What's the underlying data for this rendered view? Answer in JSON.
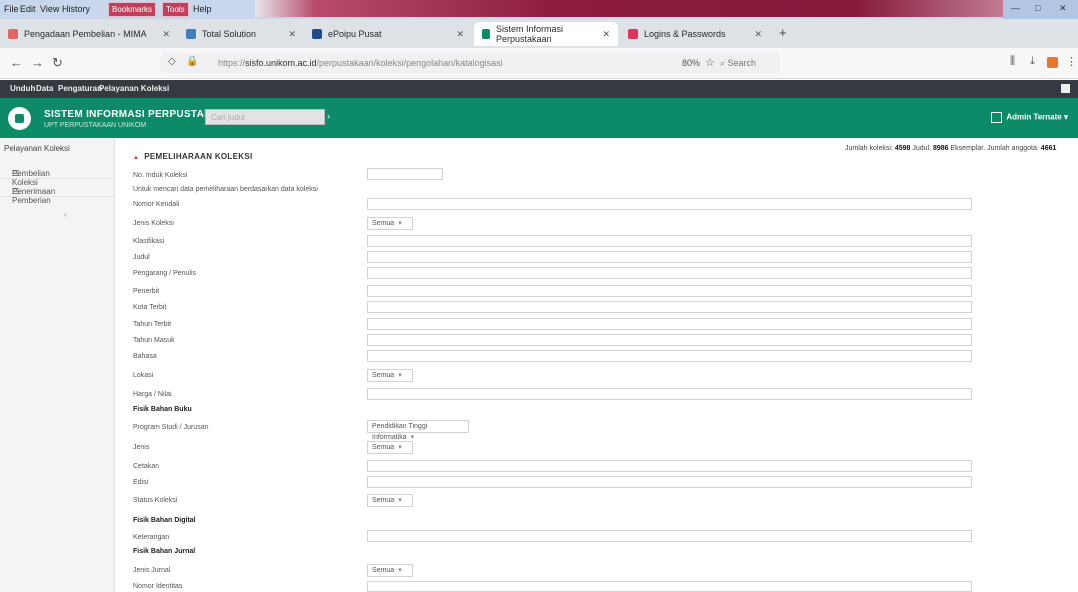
{
  "menubar": {
    "items": [
      "File",
      "Edit",
      "View",
      "History",
      "Bookmarks",
      "Tools",
      "Help"
    ],
    "window_controls": {
      "minimize": "—",
      "maximize": "□",
      "close": "✕"
    }
  },
  "tabs": [
    {
      "label": "Pengadaan Pembelian - MIMA",
      "icon_color": "#e06666"
    },
    {
      "label": "Total Solution",
      "icon_color": "#3d7fb8"
    },
    {
      "label": "ePoipu Pusat",
      "icon_color": "#1d4e89"
    },
    {
      "label": "Sistem Informasi Perpustakaan",
      "icon_color": "#0d8a68",
      "active": true
    },
    {
      "label": "Logins & Passwords",
      "icon_color": "#e0325a"
    }
  ],
  "address": {
    "url_prefix": "https://",
    "url_host": "sisfo.unikom.ac.id",
    "url_path": "/perpustakaan/koleksi/pengolahan/katalogisasi",
    "zoom": "80%",
    "search_placeholder": "Search"
  },
  "appnav": {
    "items": [
      "Unduh",
      "Data",
      "Pengaturan",
      "Pelayanan Koleksi"
    ]
  },
  "header": {
    "title": "SISTEM INFORMASI PERPUSTAKAAN",
    "subtitle": "UPT PERPUSTAKAAN UNIKOM",
    "search_placeholder": "Cari judul",
    "search_btn": "›",
    "user": "Admin Ternate"
  },
  "sidebar": {
    "title": "Pelayanan Koleksi",
    "items": [
      "Pembelian Koleksi",
      "Penerimaan Pemberian"
    ],
    "toggle": "‹"
  },
  "stats": {
    "label1": "Jumlah koleksi:",
    "value1": "4598",
    "label2": "Judul,",
    "value2": "8986",
    "label3": "Eksemplar. Jumlah anggota:",
    "value3": "4661"
  },
  "form": {
    "title": "PEMELIHARAAN KOLEKSI",
    "fields": {
      "no_induk": "No. Induk Koleksi",
      "hint": "Untuk mencari data pemeliharaan berdasarkan data koleksi",
      "nomor_kendali": "Nomor Kendali",
      "jenis_koleksi": "Jenis Koleksi",
      "klasifikasi": "Klasifikasi",
      "judul": "Judul",
      "pengarang": "Pengarang / Penulis",
      "penerbit": "Penerbit",
      "kota_terbit": "Kota Terbit",
      "tahun_terbit": "Tahun Terbit",
      "tahun_masuk": "Tahun Masuk",
      "bahasa": "Bahasa",
      "lokasi": "Lokasi",
      "harga": "Harga / Nilai",
      "sec_buku": "Fisik Bahan Buku",
      "program_studi": "Program Studi / Jurusan",
      "jenis": "Jenis",
      "cetakan": "Cetakan",
      "edisi": "Edisi",
      "status_koleksi": "Status Koleksi",
      "sec_digital": "Fisik Bahan Digital",
      "keterangan": "Keterangan",
      "sec_jurnal": "Fisik Bahan Jurnal",
      "jenis_jurnal": "Jenis Jurnal",
      "nomor_identitas": "Nomor Identitas"
    },
    "selects": {
      "jenis_koleksi": "Semua",
      "lokasi": "Semua",
      "program_studi": "Pendidikan Tinggi Informatika",
      "jenis": "Semua",
      "status_koleksi": "Semua",
      "jenis_jurnal": "Semua"
    },
    "caret": "▾"
  }
}
